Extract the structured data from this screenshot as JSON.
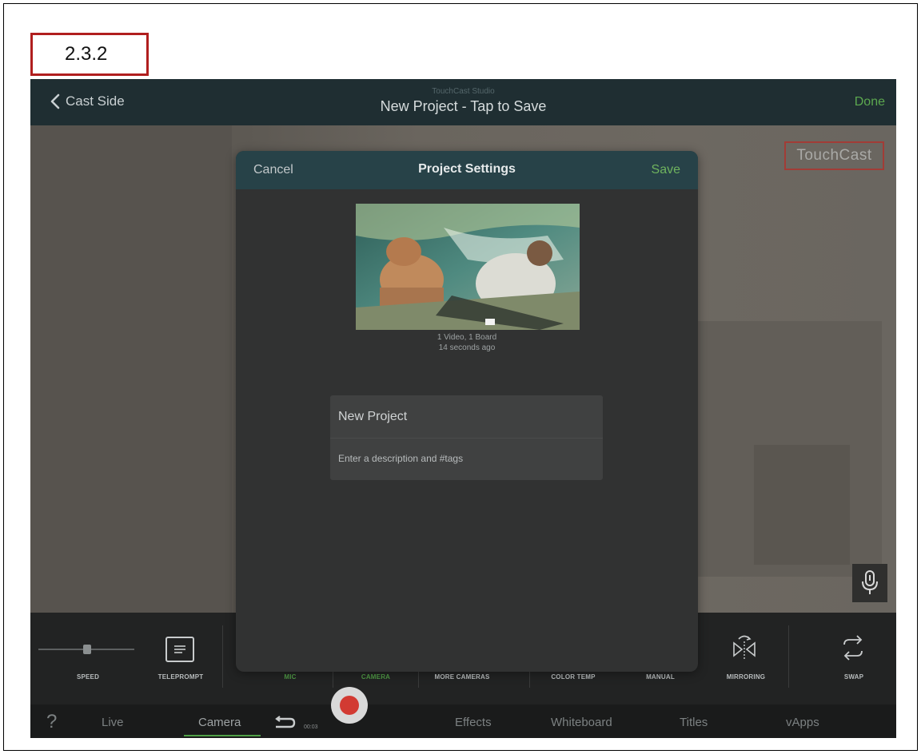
{
  "step_label": "2.3.2",
  "navbar": {
    "back_label": "Cast Side",
    "subtitle": "TouchCast Studio",
    "title": "New Project - Tap to Save",
    "done_label": "Done"
  },
  "watermark": "TouchCast",
  "modal": {
    "cancel_label": "Cancel",
    "title": "Project Settings",
    "save_label": "Save",
    "caption_line1": "1 Video, 1 Board",
    "caption_line2": "14 seconds ago",
    "project_name": "New Project",
    "description_placeholder": "Enter a description and #tags"
  },
  "toolbar": {
    "items": [
      {
        "label": "SPEED"
      },
      {
        "label": "TELEPROMPT"
      },
      {
        "label": "MIC"
      },
      {
        "label": "CAMERA"
      },
      {
        "label": "MORE CAMERAS"
      },
      {
        "label": "COLOR TEMP"
      },
      {
        "label": "MANUAL"
      },
      {
        "label": "MIRRORING"
      },
      {
        "label": "SWAP"
      }
    ]
  },
  "tabs": {
    "help": "?",
    "live": "Live",
    "camera": "Camera",
    "timer": "00:03",
    "effects": "Effects",
    "whiteboard": "Whiteboard",
    "titles": "Titles",
    "vapps": "vApps"
  },
  "colors": {
    "accent_green": "#5ca84f",
    "navbar": "#1f2e32",
    "modal_header": "#274248",
    "record_red": "#d23a32",
    "label_border": "#b01e1e"
  }
}
